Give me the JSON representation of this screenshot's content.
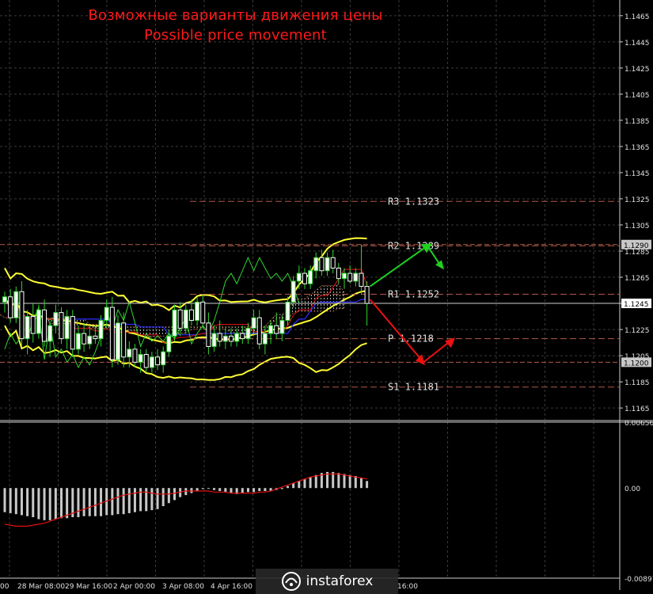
{
  "title_ru": "Возможные варианты движения цены",
  "title_en": "Possible price movement",
  "watermark": "instaforex",
  "chart_data": [
    {
      "type": "candlestick",
      "instrument": "EUR/USD",
      "y_ticks": [
        "1.1465",
        "1.1445",
        "1.1425",
        "1.1405",
        "1.1385",
        "1.1365",
        "1.1345",
        "1.1325",
        "1.1305",
        "1.1285",
        "1.1265",
        "1.1245",
        "1.1225",
        "1.1205",
        "1.1185",
        "1.1165"
      ],
      "ylim": [
        1.1156,
        1.1477
      ],
      "x_ticks": [
        "28 Mar 08:00",
        "29 Mar 16:00",
        "2 Apr 00:00",
        "3 Apr 08:00",
        "4 Apr 16:00"
      ],
      "levels": [
        {
          "label": "R3",
          "value": "1.1323"
        },
        {
          "label": "R2",
          "value": "1.1289"
        },
        {
          "label": "R1",
          "value": "1.1252"
        },
        {
          "label": "P",
          "value": "1.1218"
        },
        {
          "label": "S1",
          "value": "1.1181"
        }
      ],
      "price_tags": [
        {
          "value": "1.1290",
          "kind": "resistance",
          "color": "#c8c8c8"
        },
        {
          "value": "1.1245",
          "kind": "current",
          "color": "#ffffff"
        },
        {
          "value": "1.1200",
          "kind": "support",
          "color": "#c8c8c8"
        }
      ],
      "candles": [
        {
          "o": 1.1246,
          "h": 1.1254,
          "l": 1.1238,
          "c": 1.125
        },
        {
          "o": 1.125,
          "h": 1.1256,
          "l": 1.123,
          "c": 1.1234
        },
        {
          "o": 1.1234,
          "h": 1.1258,
          "l": 1.123,
          "c": 1.1254
        },
        {
          "o": 1.1254,
          "h": 1.1262,
          "l": 1.1212,
          "c": 1.1218
        },
        {
          "o": 1.1218,
          "h": 1.124,
          "l": 1.1206,
          "c": 1.1235
        },
        {
          "o": 1.1235,
          "h": 1.1245,
          "l": 1.1215,
          "c": 1.1222
        },
        {
          "o": 1.1222,
          "h": 1.1244,
          "l": 1.1218,
          "c": 1.124
        },
        {
          "o": 1.124,
          "h": 1.1248,
          "l": 1.1212,
          "c": 1.1216
        },
        {
          "o": 1.1216,
          "h": 1.1232,
          "l": 1.1204,
          "c": 1.1228
        },
        {
          "o": 1.1228,
          "h": 1.1244,
          "l": 1.1222,
          "c": 1.1238
        },
        {
          "o": 1.1238,
          "h": 1.1242,
          "l": 1.1214,
          "c": 1.1218
        },
        {
          "o": 1.1218,
          "h": 1.124,
          "l": 1.121,
          "c": 1.1235
        },
        {
          "o": 1.1235,
          "h": 1.124,
          "l": 1.1204,
          "c": 1.121
        },
        {
          "o": 1.121,
          "h": 1.1228,
          "l": 1.1206,
          "c": 1.1222
        },
        {
          "o": 1.1222,
          "h": 1.123,
          "l": 1.1208,
          "c": 1.1214
        },
        {
          "o": 1.1214,
          "h": 1.1226,
          "l": 1.121,
          "c": 1.122
        },
        {
          "o": 1.122,
          "h": 1.1228,
          "l": 1.1214,
          "c": 1.1218
        },
        {
          "o": 1.1218,
          "h": 1.1236,
          "l": 1.1212,
          "c": 1.1232
        },
        {
          "o": 1.1232,
          "h": 1.1248,
          "l": 1.1226,
          "c": 1.1242
        },
        {
          "o": 1.1242,
          "h": 1.125,
          "l": 1.1196,
          "c": 1.1202
        },
        {
          "o": 1.1202,
          "h": 1.1236,
          "l": 1.1198,
          "c": 1.123
        },
        {
          "o": 1.123,
          "h": 1.1238,
          "l": 1.1196,
          "c": 1.1204
        },
        {
          "o": 1.1204,
          "h": 1.1216,
          "l": 1.1196,
          "c": 1.121
        },
        {
          "o": 1.121,
          "h": 1.1214,
          "l": 1.1196,
          "c": 1.12
        },
        {
          "o": 1.12,
          "h": 1.121,
          "l": 1.1192,
          "c": 1.1206
        },
        {
          "o": 1.1206,
          "h": 1.121,
          "l": 1.1192,
          "c": 1.1196
        },
        {
          "o": 1.1196,
          "h": 1.1208,
          "l": 1.1192,
          "c": 1.1204
        },
        {
          "o": 1.1204,
          "h": 1.121,
          "l": 1.1194,
          "c": 1.1198
        },
        {
          "o": 1.1198,
          "h": 1.1212,
          "l": 1.1192,
          "c": 1.1208
        },
        {
          "o": 1.1208,
          "h": 1.1224,
          "l": 1.1204,
          "c": 1.122
        },
        {
          "o": 1.122,
          "h": 1.1244,
          "l": 1.1216,
          "c": 1.124
        },
        {
          "o": 1.124,
          "h": 1.1246,
          "l": 1.122,
          "c": 1.1226
        },
        {
          "o": 1.1226,
          "h": 1.1244,
          "l": 1.1222,
          "c": 1.124
        },
        {
          "o": 1.124,
          "h": 1.1248,
          "l": 1.1228,
          "c": 1.1232
        },
        {
          "o": 1.1232,
          "h": 1.125,
          "l": 1.1228,
          "c": 1.1246
        },
        {
          "o": 1.1246,
          "h": 1.1252,
          "l": 1.1226,
          "c": 1.123
        },
        {
          "o": 1.123,
          "h": 1.1238,
          "l": 1.1206,
          "c": 1.1212
        },
        {
          "o": 1.1212,
          "h": 1.1228,
          "l": 1.1208,
          "c": 1.1222
        },
        {
          "o": 1.1222,
          "h": 1.1232,
          "l": 1.1212,
          "c": 1.1216
        },
        {
          "o": 1.1216,
          "h": 1.1226,
          "l": 1.121,
          "c": 1.122
        },
        {
          "o": 1.122,
          "h": 1.1226,
          "l": 1.1212,
          "c": 1.1216
        },
        {
          "o": 1.1216,
          "h": 1.1226,
          "l": 1.1212,
          "c": 1.1222
        },
        {
          "o": 1.1222,
          "h": 1.1228,
          "l": 1.1214,
          "c": 1.1218
        },
        {
          "o": 1.1218,
          "h": 1.123,
          "l": 1.1214,
          "c": 1.1226
        },
        {
          "o": 1.1226,
          "h": 1.124,
          "l": 1.122,
          "c": 1.1234
        },
        {
          "o": 1.1234,
          "h": 1.124,
          "l": 1.121,
          "c": 1.1214
        },
        {
          "o": 1.1214,
          "h": 1.1228,
          "l": 1.1206,
          "c": 1.1222
        },
        {
          "o": 1.1222,
          "h": 1.1232,
          "l": 1.1214,
          "c": 1.1228
        },
        {
          "o": 1.1228,
          "h": 1.1238,
          "l": 1.1218,
          "c": 1.1222
        },
        {
          "o": 1.1222,
          "h": 1.1236,
          "l": 1.1216,
          "c": 1.1232
        },
        {
          "o": 1.1232,
          "h": 1.125,
          "l": 1.1228,
          "c": 1.1246
        },
        {
          "o": 1.1246,
          "h": 1.1266,
          "l": 1.1242,
          "c": 1.1262
        },
        {
          "o": 1.1262,
          "h": 1.1274,
          "l": 1.1256,
          "c": 1.1268
        },
        {
          "o": 1.1268,
          "h": 1.1272,
          "l": 1.1256,
          "c": 1.126
        },
        {
          "o": 1.126,
          "h": 1.1274,
          "l": 1.1256,
          "c": 1.127
        },
        {
          "o": 1.127,
          "h": 1.1284,
          "l": 1.1264,
          "c": 1.128
        },
        {
          "o": 1.128,
          "h": 1.1286,
          "l": 1.1266,
          "c": 1.127
        },
        {
          "o": 1.127,
          "h": 1.1284,
          "l": 1.1266,
          "c": 1.128
        },
        {
          "o": 1.128,
          "h": 1.1286,
          "l": 1.1268,
          "c": 1.1272
        },
        {
          "o": 1.1272,
          "h": 1.1276,
          "l": 1.126,
          "c": 1.1264
        },
        {
          "o": 1.1264,
          "h": 1.1272,
          "l": 1.1256,
          "c": 1.1268
        },
        {
          "o": 1.1268,
          "h": 1.1274,
          "l": 1.126,
          "c": 1.1262
        },
        {
          "o": 1.1262,
          "h": 1.1272,
          "l": 1.1258,
          "c": 1.1268
        },
        {
          "o": 1.1268,
          "h": 1.129,
          "l": 1.1252,
          "c": 1.1258
        },
        {
          "o": 1.1258,
          "h": 1.1262,
          "l": 1.1228,
          "c": 1.1245
        }
      ],
      "forecast_arrows": [
        {
          "direction": "up",
          "from": 1.1258,
          "to": 1.1289,
          "color": "#20d020"
        },
        {
          "direction": "down",
          "from": 1.1248,
          "to": 1.12,
          "color": "#ee1010"
        }
      ],
      "indicator": {
        "name": "MACD",
        "y_ticks": [
          "0.00656",
          "0.00",
          "-0.00897"
        ],
        "ylim": [
          -0.00897,
          0.00656
        ],
        "histogram": [
          -0.0024,
          -0.0025,
          -0.0026,
          -0.0027,
          -0.0028,
          -0.0029,
          -0.0031,
          -0.0032,
          -0.0032,
          -0.0031,
          -0.003,
          -0.003,
          -0.0029,
          -0.0029,
          -0.0028,
          -0.0028,
          -0.0028,
          -0.0028,
          -0.0027,
          -0.0027,
          -0.0026,
          -0.0026,
          -0.0025,
          -0.0024,
          -0.0023,
          -0.0023,
          -0.0022,
          -0.0021,
          -0.0018,
          -0.0015,
          -0.0012,
          -0.0009,
          -0.0007,
          -0.0005,
          -0.0003,
          -0.0001,
          0.0,
          -0.0002,
          -0.0003,
          -0.0004,
          -0.0005,
          -0.0006,
          -0.0005,
          -0.0004,
          -0.0004,
          -0.0003,
          -0.0003,
          -0.0003,
          -0.0002,
          -0.0001,
          0.0002,
          0.0005,
          0.0007,
          0.0009,
          0.0011,
          0.0013,
          0.0015,
          0.0016,
          0.0016,
          0.0015,
          0.0014,
          0.0013,
          0.0012,
          0.001,
          0.0007
        ],
        "signal": [
          -0.0036,
          -0.0037,
          -0.0038,
          -0.0038,
          -0.0038,
          -0.0037,
          -0.0036,
          -0.0035,
          -0.0033,
          -0.0031,
          -0.0029,
          -0.0027,
          -0.0025,
          -0.0023,
          -0.0021,
          -0.0019,
          -0.0017,
          -0.0015,
          -0.0013,
          -0.0011,
          -0.0009,
          -0.0007,
          -0.0006,
          -0.0005,
          -0.0004,
          -0.0004,
          -0.0005,
          -0.0006,
          -0.0006,
          -0.0006,
          -0.0005,
          -0.0004,
          -0.0003,
          -0.0003,
          -0.0003,
          -0.0003,
          -0.0003,
          -0.0004,
          -0.0004,
          -0.0004,
          -0.0005,
          -0.0005,
          -0.0005,
          -0.0005,
          -0.0005,
          -0.0004,
          -0.0004,
          -0.0003,
          -0.0001,
          0.0001,
          0.0003,
          0.0005,
          0.0007,
          0.0009,
          0.0011,
          0.0012,
          0.0013,
          0.0014,
          0.0014,
          0.0014,
          0.0013,
          0.0012,
          0.0011,
          0.001,
          0.0009
        ]
      },
      "colors": {
        "background": "#000000",
        "grid": "#3a3a3a",
        "bull_candle": "#ffffff",
        "bear_candle": "#ffffff",
        "wick": "#2fd62f",
        "bollinger": "#ffff33",
        "ichimoku_cloud": "#e8e8e8",
        "kijun": "#2d2dff",
        "tenkan": "#e01010",
        "chikou": "#2fd62f",
        "level_line": "#b05a4a",
        "level_text": "#e0e0e0",
        "histogram": "#c8c8c8",
        "signal": "#e01010",
        "axis_text": "#e0e0e0"
      }
    }
  ]
}
